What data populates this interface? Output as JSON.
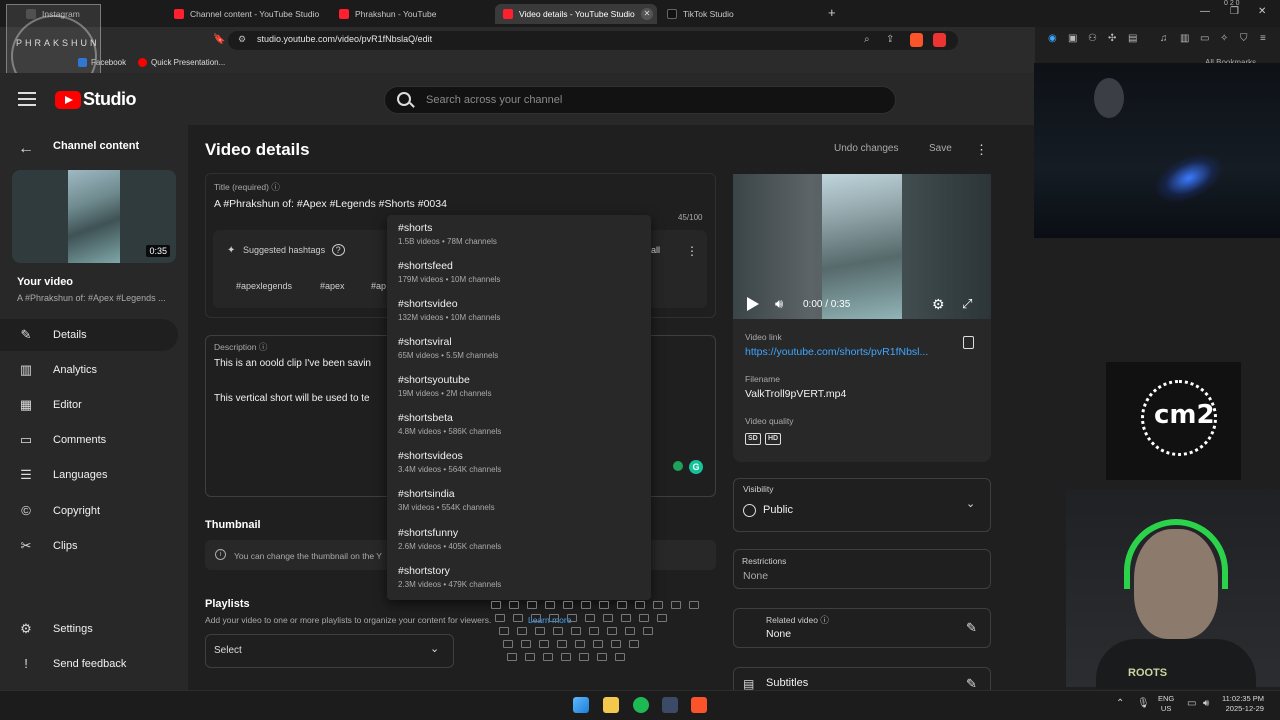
{
  "browser": {
    "tabs": [
      {
        "label": "Instagram",
        "icon": "instagram-icon"
      },
      {
        "label": "Channel content - YouTube Studio",
        "icon": "youtube-icon"
      },
      {
        "label": "Phrakshun - YouTube",
        "icon": "youtube-icon"
      },
      {
        "label": "Video details - YouTube Studio",
        "icon": "youtube-icon",
        "active": true
      },
      {
        "label": "TikTok Studio",
        "icon": "tiktok-icon"
      }
    ],
    "url": "studio.youtube.com/video/pvR1fNbslaQ/edit",
    "bookmarks": [
      {
        "label": "Facebook"
      },
      {
        "label": "Quick Presentation..."
      }
    ],
    "bookmarks_right": "All Bookmarks",
    "status_badges": "0 2 0"
  },
  "overlay": {
    "brand": "PHRAKSHUN"
  },
  "studio": {
    "logo_text": "Studio",
    "search_placeholder": "Search across your channel"
  },
  "sidebar": {
    "back_label": "Channel content",
    "thumb_duration": "0:35",
    "your_video_label": "Your video",
    "your_video_title": "A #Phrakshun of: #Apex #Legends ...",
    "items": [
      {
        "label": "Details",
        "icon": "pencil-icon",
        "active": true
      },
      {
        "label": "Analytics",
        "icon": "analytics-icon"
      },
      {
        "label": "Editor",
        "icon": "editor-icon"
      },
      {
        "label": "Comments",
        "icon": "comments-icon"
      },
      {
        "label": "Languages",
        "icon": "languages-icon"
      },
      {
        "label": "Copyright",
        "icon": "copyright-icon"
      },
      {
        "label": "Clips",
        "icon": "scissors-icon"
      }
    ],
    "footer": [
      {
        "label": "Settings",
        "icon": "gear-icon"
      },
      {
        "label": "Send feedback",
        "icon": "feedback-icon"
      }
    ]
  },
  "main": {
    "title": "Video details",
    "undo_label": "Undo changes",
    "save_label": "Save",
    "title_field": {
      "label": "Title (required)",
      "value": "A #Phrakshun of: #Apex #Legends #Shorts #0034",
      "count": "45/100"
    },
    "hashtags": {
      "label": "Suggested hashtags",
      "all_label": "all",
      "tags": [
        "#apexlegends",
        "#apex",
        "#ap"
      ]
    },
    "description": {
      "label": "Description",
      "line1": "This is an ooold clip I've been savin",
      "line2": "This vertical short will be used to te"
    },
    "thumbnail": {
      "heading": "Thumbnail",
      "note": "You can change the thumbnail on the Y"
    },
    "playlists": {
      "heading": "Playlists",
      "sub": "Add your video to one or more playlists to organize your content for viewers.",
      "learn_more": "Learn more",
      "select_value": "Select"
    }
  },
  "suggestions": [
    {
      "tag": "#shorts",
      "stats": "1.5B videos • 78M channels"
    },
    {
      "tag": "#shortsfeed",
      "stats": "179M videos • 10M channels"
    },
    {
      "tag": "#shortsvideo",
      "stats": "132M videos • 10M channels"
    },
    {
      "tag": "#shortsviral",
      "stats": "65M videos • 5.5M channels"
    },
    {
      "tag": "#shortsyoutube",
      "stats": "19M videos • 2M channels"
    },
    {
      "tag": "#shortsbeta",
      "stats": "4.8M videos • 586K channels"
    },
    {
      "tag": "#shortsvideos",
      "stats": "3.4M videos • 564K channels"
    },
    {
      "tag": "#shortsindia",
      "stats": "3M videos • 554K channels"
    },
    {
      "tag": "#shortsfunny",
      "stats": "2.6M videos • 405K channels"
    },
    {
      "tag": "#shortstory",
      "stats": "2.3M videos • 479K channels"
    }
  ],
  "right": {
    "time": "0:00 / 0:35",
    "video_link_label": "Video link",
    "video_link": "https://youtube.com/shorts/pvR1fNbsl...",
    "filename_label": "Filename",
    "filename": "ValkTroll9pVERT.mp4",
    "quality_label": "Video quality",
    "quality_badges": [
      "SD",
      "HD"
    ],
    "visibility_label": "Visibility",
    "visibility_value": "Public",
    "restrictions_label": "Restrictions",
    "restrictions_value": "None",
    "related_label": "Related video",
    "related_value": "None",
    "subtitles_label": "Subtitles"
  },
  "stream": {
    "logo": "cm2",
    "cam_text": "ROOTS"
  },
  "taskbar": {
    "lang": "ENG",
    "region": "US",
    "time": "11:02:35 PM",
    "date": "2025-12-29"
  }
}
